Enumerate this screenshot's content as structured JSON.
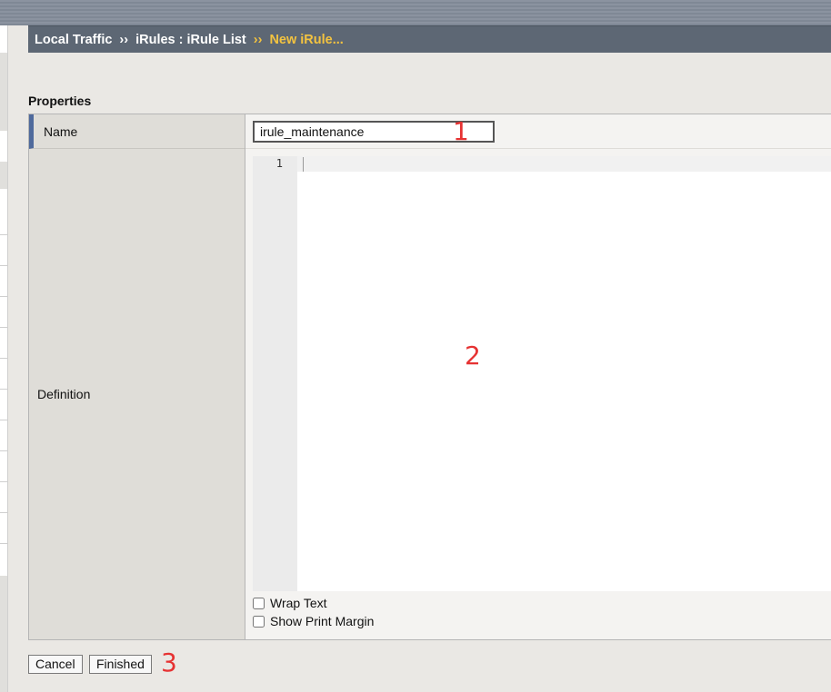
{
  "breadcrumb": {
    "items": [
      "Local Traffic",
      "iRules : iRule List"
    ],
    "separator": "››",
    "current": "New iRule..."
  },
  "section": {
    "title": "Properties"
  },
  "form": {
    "name_label": "Name",
    "name_value": "irule_maintenance",
    "definition_label": "Definition",
    "editor": {
      "line_number": "1"
    },
    "wrap_text_label": "Wrap Text",
    "show_print_margin_label": "Show Print Margin",
    "wrap_text_checked": false,
    "show_print_margin_checked": false
  },
  "buttons": {
    "cancel": "Cancel",
    "finished": "Finished"
  },
  "annotations": [
    "1",
    "2",
    "3"
  ],
  "colors": {
    "breadcrumb_bg": "#5d6774",
    "breadcrumb_current": "#f3c340",
    "name_row_accent": "#4f6a9c",
    "annotation": "#e63232"
  }
}
